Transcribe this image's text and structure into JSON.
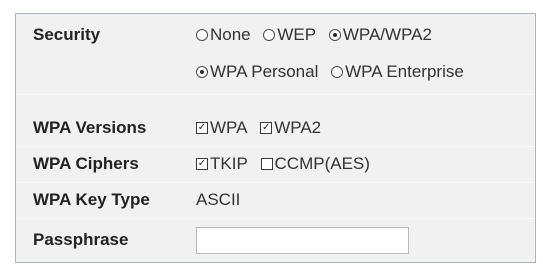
{
  "security": {
    "label": "Security",
    "options": [
      "None",
      "WEP",
      "WPA/WPA2"
    ],
    "selected": "WPA/WPA2",
    "mode_options": [
      "WPA Personal",
      "WPA Enterprise"
    ],
    "mode_selected": "WPA Personal"
  },
  "wpa_versions": {
    "label": "WPA Versions",
    "options": [
      {
        "label": "WPA",
        "checked": true
      },
      {
        "label": "WPA2",
        "checked": true
      }
    ]
  },
  "wpa_ciphers": {
    "label": "WPA Ciphers",
    "options": [
      {
        "label": "TKIP",
        "checked": true
      },
      {
        "label": "CCMP(AES)",
        "checked": false
      }
    ]
  },
  "wpa_key_type": {
    "label": "WPA Key Type",
    "value": "ASCII"
  },
  "passphrase": {
    "label": "Passphrase",
    "value": "",
    "placeholder": ""
  },
  "colors": {
    "panel_bg": "#f1f1f1",
    "panel_border": "#a9b4c4",
    "divider": "#ffffff"
  }
}
